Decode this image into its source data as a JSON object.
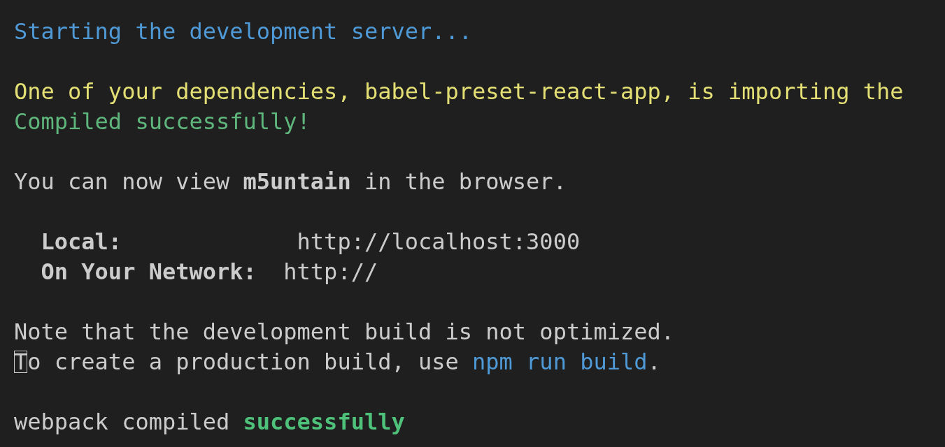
{
  "terminal": {
    "lines": [
      {
        "kind": "text",
        "segments": [
          {
            "text": "Starting the development server...",
            "color": "#4f9ad6"
          }
        ]
      },
      {
        "kind": "blank"
      },
      {
        "kind": "text",
        "segments": [
          {
            "text": "One of your dependencies, babel-preset-react-app, is importing the",
            "color": "#e3df74"
          }
        ]
      },
      {
        "kind": "text",
        "segments": [
          {
            "text": "Compiled successfully!",
            "color": "#5fb67c"
          }
        ]
      },
      {
        "kind": "blank"
      },
      {
        "kind": "text",
        "segments": [
          {
            "text": "You can now view ",
            "color": "#cccccc"
          },
          {
            "text": "m5untain",
            "color": "#cccccc",
            "bold": true
          },
          {
            "text": " in the browser.",
            "color": "#cccccc"
          }
        ]
      },
      {
        "kind": "blank"
      },
      {
        "kind": "text",
        "segments": [
          {
            "text": "  Local:",
            "color": "#cccccc",
            "bold": true
          },
          {
            "text": "             http://localhost:3000",
            "color": "#cccccc"
          }
        ]
      },
      {
        "kind": "text",
        "segments": [
          {
            "text": "  On Your Network:",
            "color": "#cccccc",
            "bold": true
          },
          {
            "text": "  http://",
            "color": "#cccccc"
          }
        ]
      },
      {
        "kind": "blank"
      },
      {
        "kind": "text",
        "segments": [
          {
            "text": "Note that the development build is not optimized.",
            "color": "#cccccc"
          }
        ]
      },
      {
        "kind": "text",
        "segments": [
          {
            "text": "T",
            "color": "#cccccc",
            "cursor": true
          },
          {
            "text": "o create a production build, use ",
            "color": "#cccccc"
          },
          {
            "text": "npm run build",
            "color": "#4f9ad6"
          },
          {
            "text": ".",
            "color": "#cccccc"
          }
        ]
      },
      {
        "kind": "blank"
      },
      {
        "kind": "text",
        "segments": [
          {
            "text": "webpack compiled ",
            "color": "#cccccc"
          },
          {
            "text": "successfully",
            "color": "#4ec27a",
            "bold": true
          }
        ]
      }
    ]
  }
}
